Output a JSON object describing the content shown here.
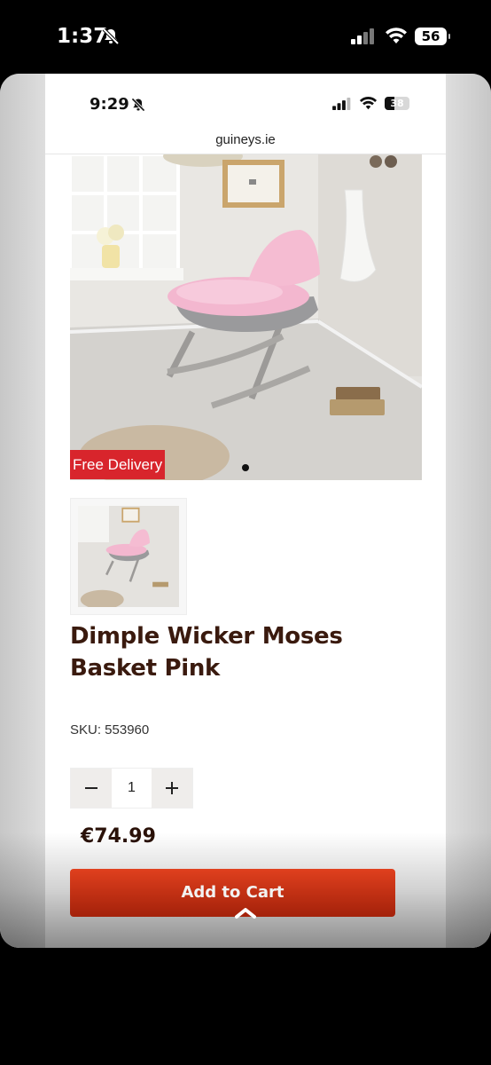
{
  "outer_status": {
    "time": "1:37",
    "battery": "56"
  },
  "inner_status": {
    "time": "9:29",
    "battery": "38",
    "battery_level": 0.38
  },
  "browser": {
    "url": "guineys.ie"
  },
  "product": {
    "badge": "Free Delivery",
    "title": "Dimple Wicker Moses Basket Pink",
    "sku": "SKU: 553960",
    "quantity": "1",
    "price": "€74.99",
    "add_to_cart_label": "Add to Cart",
    "image_count": 1,
    "active_image": 1
  },
  "icons": {
    "decrement": "minus-icon",
    "increment": "plus-icon",
    "scroll_up": "chevron-up-icon",
    "silent": "bell-slash-icon"
  },
  "colors": {
    "badge_red": "#d8252c",
    "button_red": "#c2300f",
    "title_brown": "#3a1a0e"
  }
}
